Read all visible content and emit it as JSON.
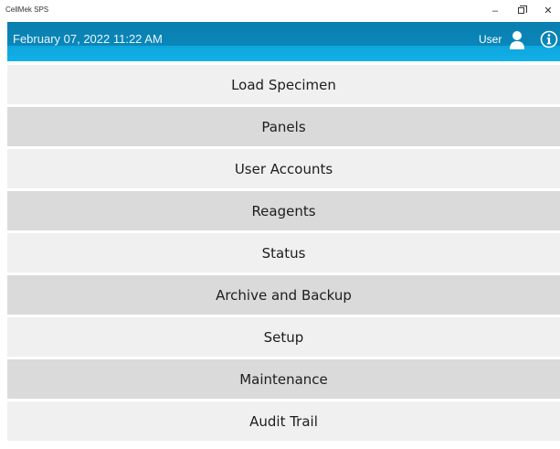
{
  "window": {
    "title": "CellMek SPS",
    "minimize_glyph": "–",
    "close_glyph": "✕"
  },
  "header": {
    "datetime": "February 07, 2022 11:22 AM",
    "user_label": "User",
    "user_icon": "user-icon",
    "info_icon": "info-icon",
    "accent_color": "#0a86b9"
  },
  "menu": {
    "items": [
      {
        "label": "Load Specimen"
      },
      {
        "label": "Panels"
      },
      {
        "label": "User Accounts"
      },
      {
        "label": "Reagents"
      },
      {
        "label": "Status"
      },
      {
        "label": "Archive and Backup"
      },
      {
        "label": "Setup"
      },
      {
        "label": "Maintenance"
      },
      {
        "label": "Audit Trail"
      }
    ]
  }
}
